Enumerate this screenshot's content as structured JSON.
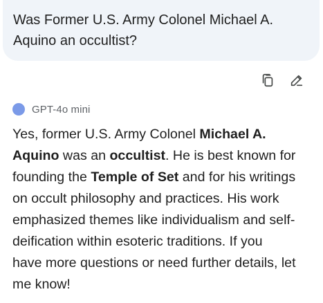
{
  "user_message": {
    "lines": [
      "Was Former U.S. Army Colonel Michael A.",
      "Aquino an occultist?"
    ]
  },
  "actions": {
    "copy_icon": "copy-icon",
    "edit_icon": "edit-pencil-icon"
  },
  "model": {
    "name": "GPT-4o mini",
    "dot_color": "#7b9ae8"
  },
  "response": {
    "l1": {
      "a": "Yes, former U.S. Army Colonel ",
      "b": "Michael A."
    },
    "l2": {
      "b1": "Aquino",
      "a1": " was an ",
      "b2": "occultist",
      "a2": ". He is best known for"
    },
    "l3": {
      "a1": "founding the ",
      "b": "Temple of Set",
      "a2": " and for his writings"
    },
    "l4": "on occult philosophy and practices. His work",
    "l5": "emphasized themes like individualism and self-",
    "l6": "deification within esoteric traditions. If you",
    "l7": "have more questions or need further details, let",
    "l8": "me know!"
  }
}
